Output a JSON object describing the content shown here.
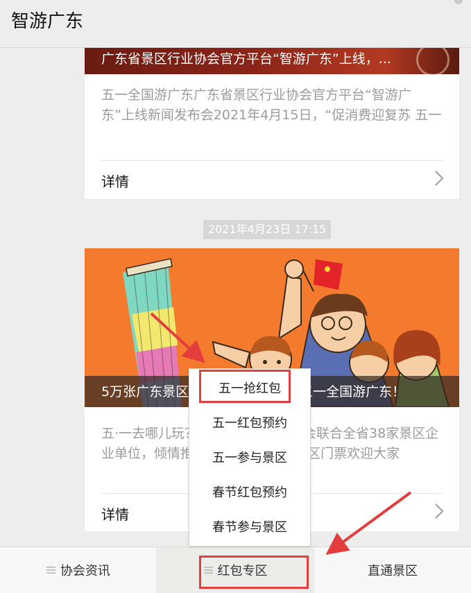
{
  "header": {
    "title": "智游广东"
  },
  "feed": {
    "card1": {
      "banner_title": "广东省景区行业协会官方平台“智游广东”上线，...",
      "description": "五一全国游广东广东省景区行业协会官方平台“智游广东”上线新闻发布会2021年4月15日，“促消费迎复苏 五一",
      "detail_label": "详情"
    },
    "timestamp": "2021年4月23日 17:15",
    "card2": {
      "banner_title_left": "5万张广东景区",
      "banner_title_right": "五一全国游广东！",
      "description": "五·一去哪儿玩？广东省景区行业协会联合全省38家景区企业单位，倾情推出免费赠送5万张景区门票欢迎大家",
      "detail_label": "详情"
    }
  },
  "popup_menu": {
    "items": [
      {
        "label": "五一抢红包",
        "highlighted": true
      },
      {
        "label": "五一红包预约"
      },
      {
        "label": "五一参与景区"
      },
      {
        "label": "春节红包预约"
      },
      {
        "label": "春节参与景区"
      }
    ]
  },
  "tabbar": {
    "tabs": [
      {
        "label": "协会资讯",
        "icon": "menu-icon"
      },
      {
        "label": "红包专区",
        "icon": "menu-icon",
        "active": true
      },
      {
        "label": "直通景区"
      }
    ]
  },
  "colors": {
    "annotation_red": "#e43d3d",
    "banner_orange": "#f47a2d",
    "page_bg": "#ededed"
  }
}
